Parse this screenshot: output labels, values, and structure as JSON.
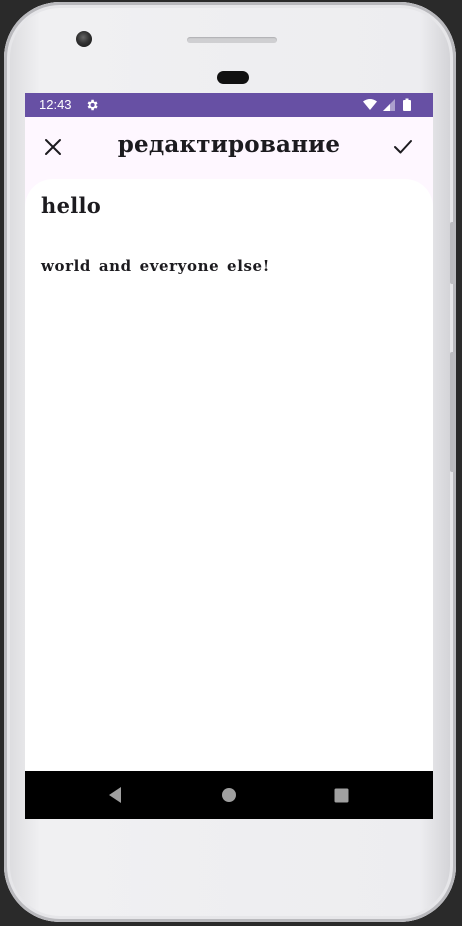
{
  "status_bar": {
    "time": "12:43",
    "icons": [
      "gear-icon",
      "wifi-icon",
      "signal-icon",
      "battery-icon"
    ],
    "background": "#6750a4"
  },
  "app_bar": {
    "title": "редактирование",
    "close_icon": "close-icon",
    "confirm_icon": "check-icon"
  },
  "note": {
    "title": "hello",
    "body": "world and everyone else!"
  },
  "nav_bar": {
    "buttons": [
      "back-icon",
      "home-icon",
      "recents-icon"
    ]
  },
  "colors": {
    "accent": "#6750a4",
    "surface": "#fef7ff",
    "text": "#1c1b1f"
  }
}
